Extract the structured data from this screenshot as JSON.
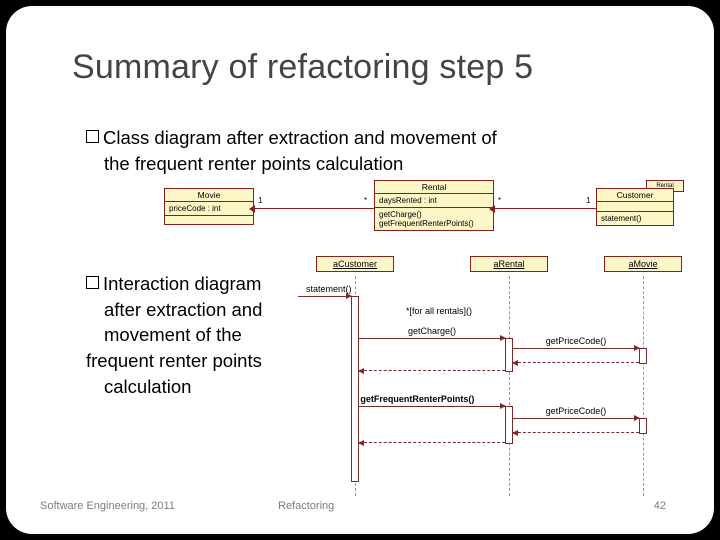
{
  "title": "Summary of refactoring step 5",
  "bullet1": "Class diagram after extraction and movement of",
  "bullet1b": "the frequent renter points calculation",
  "bullet2": "Interaction diagram",
  "bullet2_lines": {
    "a": "after extraction and",
    "b": "movement of the",
    "c": "frequent renter points",
    "d": "calculation"
  },
  "classdia": {
    "tag": "Rental",
    "movie": {
      "name": "Movie",
      "attr": "priceCode : int"
    },
    "rental": {
      "name": "Rental",
      "attr": "daysRented : int",
      "op1": "getCharge()",
      "op2": "getFrequentRenterPoints()"
    },
    "customer": {
      "name": "Customer",
      "op1": "statement()"
    },
    "mult": {
      "m1a": "1",
      "m1b": "*",
      "m2a": "*",
      "m2b": "1"
    }
  },
  "seq": {
    "objs": {
      "c": "aCustomer",
      "r": "aRental",
      "m": "aMovie"
    },
    "msgs": {
      "statement": "statement()",
      "loop": "*[for all rentals]()",
      "getCharge": "getCharge()",
      "getPriceCode1": "getPriceCode()",
      "gfrp": "getFrequentRenterPoints()",
      "getPriceCode2": "getPriceCode()"
    }
  },
  "footer": {
    "left": "Software Engineering, 2011",
    "mid": "Refactoring",
    "page": "42"
  }
}
